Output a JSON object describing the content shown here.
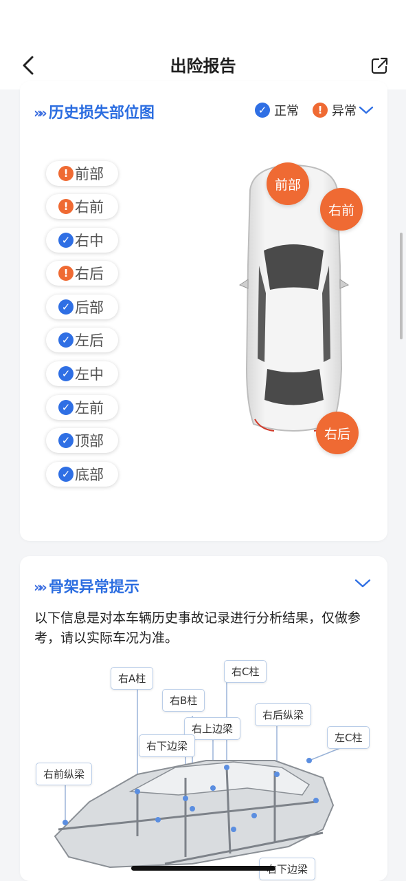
{
  "header": {
    "title": "出险报告"
  },
  "history": {
    "title": "历史损失部位图",
    "legend": {
      "normal": "正常",
      "abnormal": "异常"
    },
    "parts": [
      {
        "label": "前部",
        "status": "abnormal"
      },
      {
        "label": "右前",
        "status": "abnormal"
      },
      {
        "label": "右中",
        "status": "normal"
      },
      {
        "label": "右后",
        "status": "abnormal"
      },
      {
        "label": "后部",
        "status": "normal"
      },
      {
        "label": "左后",
        "status": "normal"
      },
      {
        "label": "左中",
        "status": "normal"
      },
      {
        "label": "左前",
        "status": "normal"
      },
      {
        "label": "顶部",
        "status": "normal"
      },
      {
        "label": "底部",
        "status": "normal"
      }
    ],
    "bubbles": [
      "前部",
      "右前",
      "右后"
    ]
  },
  "skeleton": {
    "title": "骨架异常提示",
    "note": "以下信息是对本车辆历史事故记录进行分析结果，仅做参考，请以实际车况为准。",
    "labels": [
      "右A柱",
      "右C柱",
      "右B柱",
      "右后纵梁",
      "右上边梁",
      "左C柱",
      "右下边梁",
      "右前纵梁",
      "右下边梁"
    ]
  },
  "colors": {
    "accent": "#2f6fe4",
    "warning": "#ef6a33"
  },
  "icons": {
    "back": "chevron-left-icon",
    "share": "share-icon",
    "ok": "check-circle-icon",
    "warn": "exclamation-circle-icon"
  }
}
